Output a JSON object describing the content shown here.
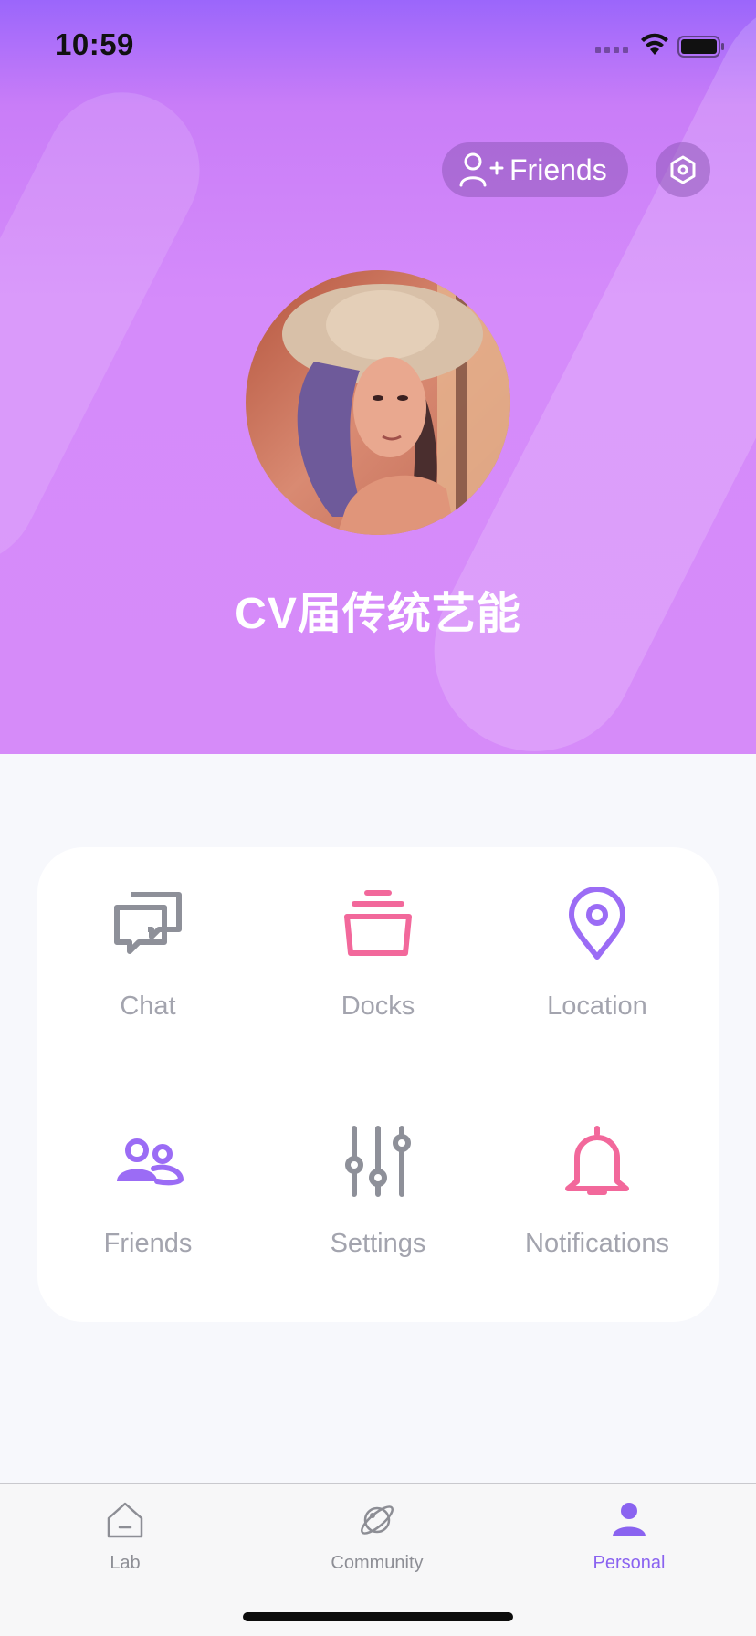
{
  "status_bar": {
    "time": "10:59"
  },
  "header": {
    "friends_button_label": "Friends",
    "username": "CV届传统艺能",
    "gradient_top": "#9B66FB",
    "gradient_bottom": "#D68BF9"
  },
  "menu": {
    "items": [
      {
        "label": "Chat",
        "icon": "chat-bubbles-icon",
        "color": "#8E9099"
      },
      {
        "label": "Docks",
        "icon": "stack-box-icon",
        "color": "#F2689B"
      },
      {
        "label": "Location",
        "icon": "map-pin-icon",
        "color": "#9B6CF5"
      },
      {
        "label": "Friends",
        "icon": "people-icon",
        "color": "#9B6CF5"
      },
      {
        "label": "Settings",
        "icon": "sliders-icon",
        "color": "#8E9099"
      },
      {
        "label": "Notifications",
        "icon": "bell-icon",
        "color": "#F2689B"
      }
    ]
  },
  "tabbar": {
    "tabs": [
      {
        "label": "Lab",
        "icon": "house-icon",
        "active": false
      },
      {
        "label": "Community",
        "icon": "planet-icon",
        "active": false
      },
      {
        "label": "Personal",
        "icon": "person-icon",
        "active": true
      }
    ],
    "active_color": "#8A63F0"
  }
}
